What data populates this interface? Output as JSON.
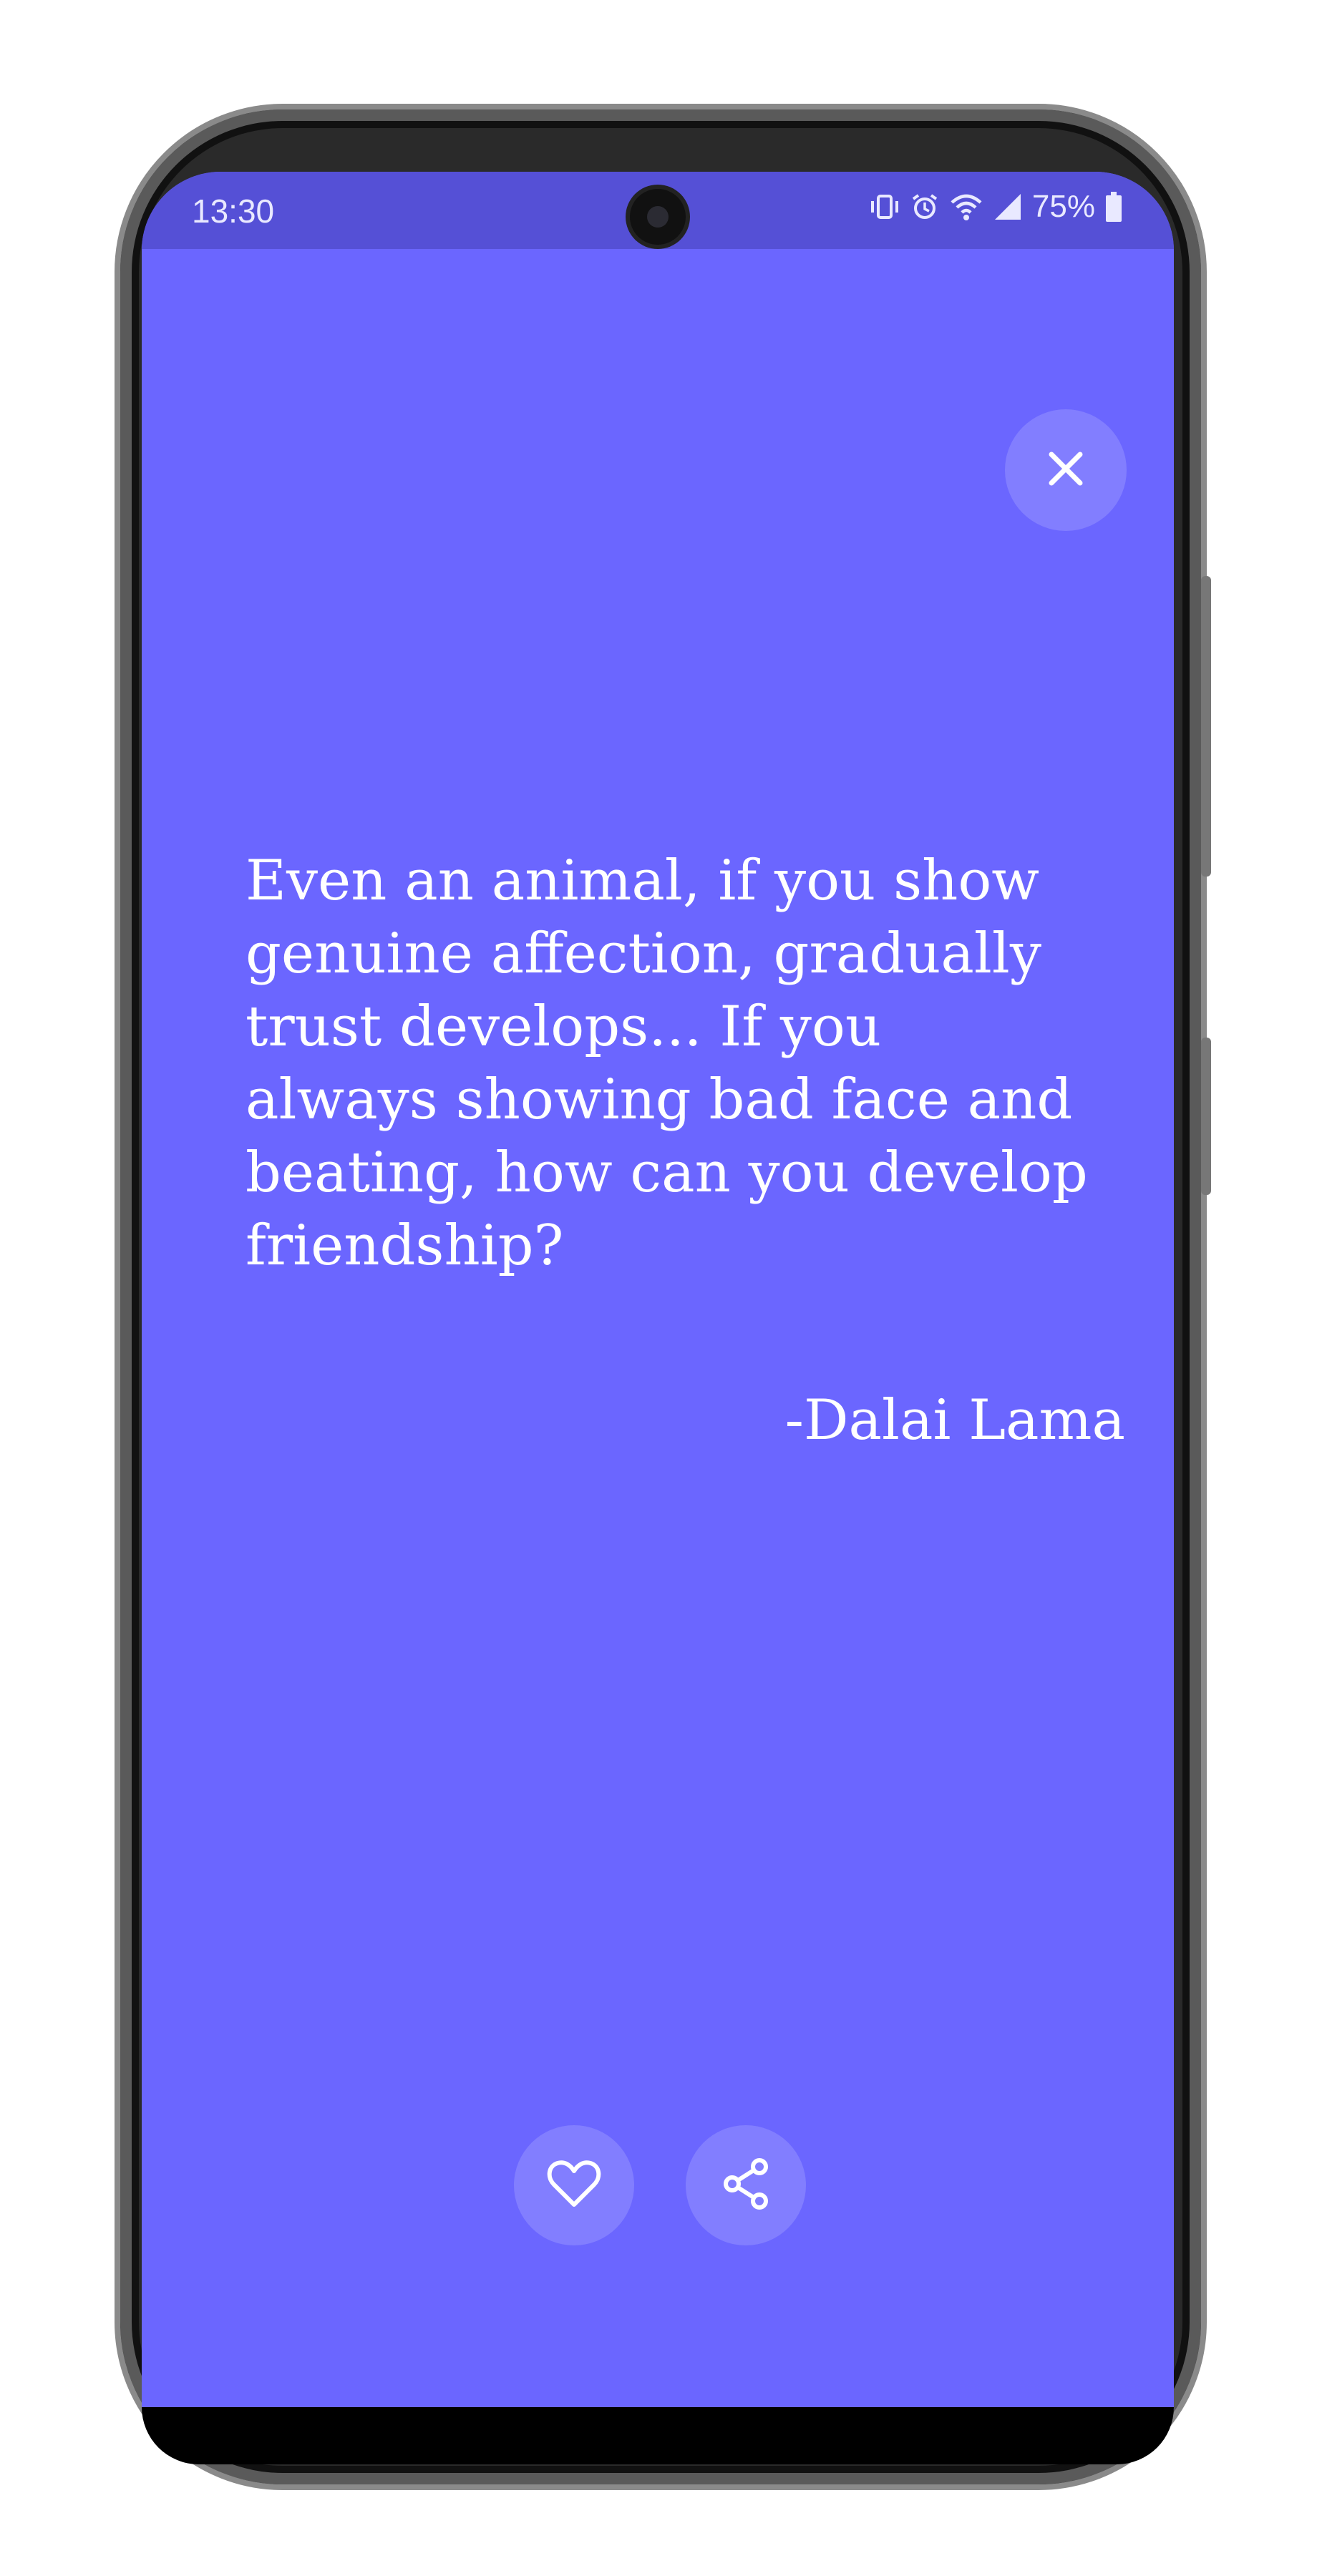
{
  "status_bar": {
    "time": "13:30",
    "battery_percent": "75%",
    "icons": [
      "vibrate-icon",
      "alarm-icon",
      "wifi-icon",
      "signal-icon",
      "battery-icon"
    ]
  },
  "quote": {
    "text": "Even an animal, if you show genuine affection, gradually trust develops... If you always showing bad face and beating, how can you develop friendship?",
    "author": "-Dalai Lama"
  },
  "actions": {
    "close_icon": "close-icon",
    "like_icon": "heart-icon",
    "share_icon": "share-icon"
  },
  "colors": {
    "background": "#6b66ff",
    "status_bar": "#5550d6",
    "text": "#ffffff"
  }
}
